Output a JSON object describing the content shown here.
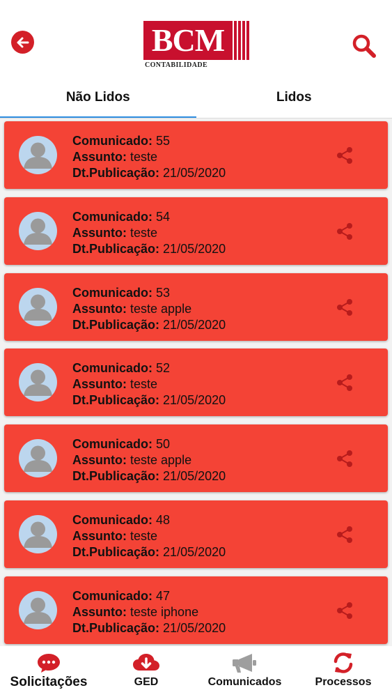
{
  "header": {
    "logo_text": "BCM",
    "logo_subtitle": "CONTABILIDADE",
    "back_icon": "arrow-left-circle-icon",
    "search_icon": "search-icon"
  },
  "tabs": [
    {
      "label": "Não Lidos",
      "active": true
    },
    {
      "label": "Lidos",
      "active": false
    }
  ],
  "labels": {
    "comunicado": "Comunicado:",
    "assunto": "Assunto:",
    "publicacao": "Dt.Publicação:"
  },
  "items": [
    {
      "comunicado": "55",
      "assunto": "teste",
      "publicacao": "21/05/2020"
    },
    {
      "comunicado": "54",
      "assunto": "teste",
      "publicacao": "21/05/2020"
    },
    {
      "comunicado": "53",
      "assunto": "teste apple",
      "publicacao": "21/05/2020"
    },
    {
      "comunicado": "52",
      "assunto": "teste",
      "publicacao": "21/05/2020"
    },
    {
      "comunicado": "50",
      "assunto": "teste apple",
      "publicacao": "21/05/2020"
    },
    {
      "comunicado": "48",
      "assunto": "teste",
      "publicacao": "21/05/2020"
    },
    {
      "comunicado": "47",
      "assunto": "teste iphone",
      "publicacao": "21/05/2020"
    }
  ],
  "bottom_nav": [
    {
      "label": "Solicitações",
      "icon": "chat-bubble-icon",
      "active": true
    },
    {
      "label": "GED",
      "icon": "cloud-download-icon",
      "active": false
    },
    {
      "label": "Comunicados",
      "icon": "megaphone-icon",
      "active": false
    },
    {
      "label": "Processos",
      "icon": "sync-icon",
      "active": false
    }
  ],
  "colors": {
    "brand_red": "#c8102e",
    "card_red": "#f44336",
    "tab_indicator": "#2f8ee0",
    "icon_grey": "#9e9e9e"
  }
}
